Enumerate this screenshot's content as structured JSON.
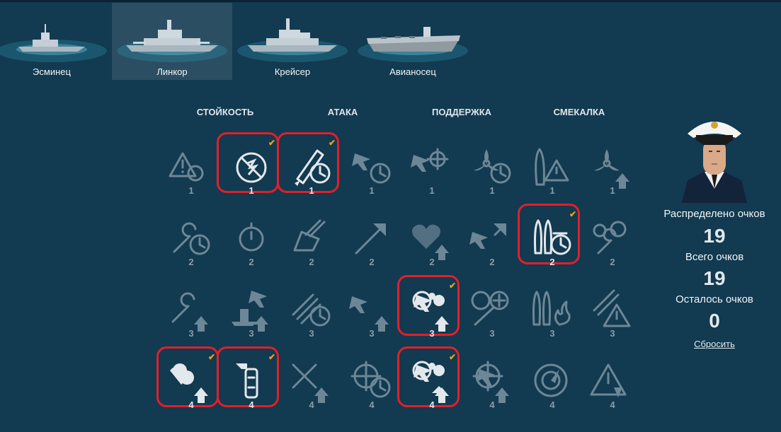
{
  "ship_tabs": [
    {
      "label": "Эсминец",
      "icon": "destroyer-icon",
      "active": false
    },
    {
      "label": "Линкор",
      "icon": "battleship-icon",
      "active": true
    },
    {
      "label": "Крейсер",
      "icon": "cruiser-icon",
      "active": false
    },
    {
      "label": "Авианосец",
      "icon": "aircraft-carrier-icon",
      "active": false
    }
  ],
  "columns": [
    "СТОЙКОСТЬ",
    "АТАКА",
    "ПОДДЕРЖКА",
    "СМЕКАЛКА"
  ],
  "skills": [
    [
      {
        "cost": "1",
        "icon": "warning-triangle-icon",
        "selected": false
      },
      {
        "cost": "1",
        "icon": "no-fire-icon",
        "selected": true
      },
      {
        "cost": "1",
        "icon": "shell-timer-icon",
        "selected": true
      },
      {
        "cost": "1",
        "icon": "aircraft-timer-icon",
        "selected": false
      },
      {
        "cost": "1",
        "icon": "fighter-crosshair-icon",
        "selected": false
      },
      {
        "cost": "1",
        "icon": "propeller-timer-icon",
        "selected": false
      },
      {
        "cost": "1",
        "icon": "hull-warning-icon",
        "selected": false
      },
      {
        "cost": "1",
        "icon": "propeller-upgrade-icon",
        "selected": false
      }
    ],
    [
      {
        "cost": "2",
        "icon": "wrench-timer-icon",
        "selected": false
      },
      {
        "cost": "2",
        "icon": "stopwatch-icon",
        "selected": false
      },
      {
        "cost": "2",
        "icon": "turret-icon",
        "selected": false
      },
      {
        "cost": "2",
        "icon": "torpedo-arrow-icon",
        "selected": false
      },
      {
        "cost": "2",
        "icon": "heart-upgrade-icon",
        "selected": false
      },
      {
        "cost": "2",
        "icon": "aircraft-arrow-icon",
        "selected": false
      },
      {
        "cost": "2",
        "icon": "torpedo-timer-icon",
        "selected": true
      },
      {
        "cost": "2",
        "icon": "gears-wrench-icon",
        "selected": false
      }
    ],
    [
      {
        "cost": "3",
        "icon": "wrench-upgrade-icon",
        "selected": false
      },
      {
        "cost": "3",
        "icon": "ship-aircraft-upgrade-icon",
        "selected": false
      },
      {
        "cost": "3",
        "icon": "guns-timer-icon",
        "selected": false
      },
      {
        "cost": "3",
        "icon": "aircraft-upgrade-icon",
        "selected": false
      },
      {
        "cost": "3",
        "icon": "aa-upgrade-icon",
        "selected": true
      },
      {
        "cost": "3",
        "icon": "aa-health-icon",
        "selected": false
      },
      {
        "cost": "3",
        "icon": "torpedo-fire-icon",
        "selected": false
      },
      {
        "cost": "3",
        "icon": "guns-warning-icon",
        "selected": false
      }
    ],
    [
      {
        "cost": "4",
        "icon": "shells-upgrade-icon",
        "selected": true
      },
      {
        "cost": "4",
        "icon": "fire-extinguisher-icon",
        "selected": true
      },
      {
        "cost": "4",
        "icon": "tools-upgrade-icon",
        "selected": false
      },
      {
        "cost": "4",
        "icon": "crosshair-timer-icon",
        "selected": false
      },
      {
        "cost": "4",
        "icon": "aa-double-upgrade-icon",
        "selected": true
      },
      {
        "cost": "4",
        "icon": "aircraft-crosshair-upgrade-icon",
        "selected": false
      },
      {
        "cost": "4",
        "icon": "radar-icon",
        "selected": false
      },
      {
        "cost": "4",
        "icon": "warning-down-icon",
        "selected": false
      }
    ]
  ],
  "stats": {
    "distributed_label": "Распределено очков",
    "distributed_value": "19",
    "total_label": "Всего очков",
    "total_value": "19",
    "remaining_label": "Осталось очков",
    "remaining_value": "0",
    "reset_label": "Сбросить"
  },
  "colors": {
    "background": "#123a50",
    "active_tab": "#2b4e63",
    "check": "#f0a21b",
    "highlight": "#e0202a",
    "icon_dim": "#6d8797",
    "icon_bright": "#e3e8ec"
  }
}
